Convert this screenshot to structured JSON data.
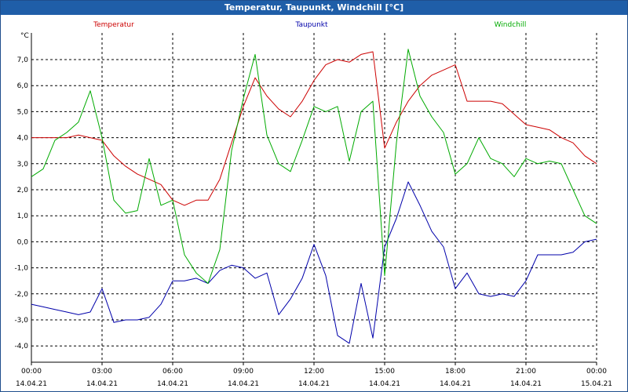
{
  "window": {
    "title": "Temperatur, Taupunkt, Windchill [°C]"
  },
  "colors": {
    "temperatur": "#cc0000",
    "taupunkt": "#0000aa",
    "windchill": "#00aa00",
    "grid": "#000000",
    "titlebar": "#1f5ea8"
  },
  "chart_data": {
    "type": "line",
    "title": "Temperatur, Taupunkt, Windchill [°C]",
    "ylabel": "°C",
    "ylim": [
      -4.5,
      8.0
    ],
    "xlim": [
      0,
      24
    ],
    "y_ticks": [
      "7,0",
      "6,0",
      "5,0",
      "4,0",
      "3,0",
      "2,0",
      "1,0",
      "0,0",
      "-1,0",
      "-2,0",
      "-3,0",
      "-4,0"
    ],
    "y_tick_values": [
      7,
      6,
      5,
      4,
      3,
      2,
      1,
      0,
      -1,
      -2,
      -3,
      -4
    ],
    "x_ticks": [
      {
        "time": "00:00",
        "date": "14.04.21",
        "hour": 0
      },
      {
        "time": "03:00",
        "date": "14.04.21",
        "hour": 3
      },
      {
        "time": "06:00",
        "date": "14.04.21",
        "hour": 6
      },
      {
        "time": "09:00",
        "date": "14.04.21",
        "hour": 9
      },
      {
        "time": "12:00",
        "date": "14.04.21",
        "hour": 12
      },
      {
        "time": "15:00",
        "date": "14.04.21",
        "hour": 15
      },
      {
        "time": "18:00",
        "date": "14.04.21",
        "hour": 18
      },
      {
        "time": "21:00",
        "date": "14.04.21",
        "hour": 21
      },
      {
        "time": "00:00",
        "date": "15.04.21",
        "hour": 24
      }
    ],
    "legend": [
      "Temperatur",
      "Taupunkt",
      "Windchill"
    ],
    "series": [
      {
        "name": "Temperatur",
        "color": "#cc0000",
        "x": [
          0,
          0.5,
          1,
          1.5,
          2,
          2.5,
          3,
          3.5,
          4,
          4.5,
          5,
          5.5,
          6,
          6.5,
          7,
          7.5,
          8,
          8.5,
          9,
          9.5,
          10,
          10.5,
          11,
          11.5,
          12,
          12.5,
          13,
          13.5,
          14,
          14.5,
          15,
          15.5,
          16,
          16.5,
          17,
          17.5,
          18,
          18.5,
          19,
          19.5,
          20,
          20.5,
          21,
          21.5,
          22,
          22.5,
          23,
          23.5,
          24
        ],
        "y": [
          4.0,
          4.0,
          4.0,
          4.0,
          4.1,
          4.0,
          3.9,
          3.3,
          2.9,
          2.6,
          2.4,
          2.2,
          1.6,
          1.4,
          1.6,
          1.6,
          2.4,
          3.8,
          5.2,
          6.3,
          5.6,
          5.1,
          4.8,
          5.4,
          6.2,
          6.8,
          7.0,
          6.9,
          7.2,
          7.3,
          3.6,
          4.6,
          5.4,
          6.0,
          6.4,
          6.6,
          6.8,
          5.4,
          5.4,
          5.4,
          5.3,
          4.9,
          4.5,
          4.4,
          4.3,
          4.0,
          3.8,
          3.3,
          3.0
        ]
      },
      {
        "name": "Taupunkt",
        "color": "#0000aa",
        "x": [
          0,
          0.5,
          1,
          1.5,
          2,
          2.5,
          3,
          3.5,
          4,
          4.5,
          5,
          5.5,
          6,
          6.5,
          7,
          7.5,
          8,
          8.5,
          9,
          9.5,
          10,
          10.5,
          11,
          11.5,
          12,
          12.5,
          13,
          13.5,
          14,
          14.5,
          15,
          15.5,
          16,
          16.5,
          17,
          17.5,
          18,
          18.5,
          19,
          19.5,
          20,
          20.5,
          21,
          21.5,
          22,
          22.5,
          23,
          23.5,
          24
        ],
        "y": [
          -2.4,
          -2.5,
          -2.6,
          -2.7,
          -2.8,
          -2.7,
          -1.8,
          -3.1,
          -3.0,
          -3.0,
          -2.9,
          -2.4,
          -1.5,
          -1.5,
          -1.4,
          -1.6,
          -1.1,
          -0.9,
          -1.0,
          -1.4,
          -1.2,
          -2.8,
          -2.2,
          -1.4,
          -0.1,
          -1.3,
          -3.6,
          -3.9,
          -1.6,
          -3.7,
          -0.2,
          0.9,
          2.3,
          1.4,
          0.4,
          -0.2,
          -1.8,
          -1.2,
          -2.0,
          -2.1,
          -2.0,
          -2.1,
          -1.5,
          -0.5,
          -0.5,
          -0.5,
          -0.4,
          0.0,
          0.1
        ]
      },
      {
        "name": "Windchill",
        "color": "#00aa00",
        "x": [
          0,
          0.5,
          1,
          1.5,
          2,
          2.5,
          3,
          3.5,
          4,
          4.5,
          5,
          5.5,
          6,
          6.5,
          7,
          7.5,
          8,
          8.5,
          9,
          9.5,
          10,
          10.5,
          11,
          11.5,
          12,
          12.5,
          13,
          13.5,
          14,
          14.5,
          15,
          15.5,
          16,
          16.5,
          17,
          17.5,
          18,
          18.5,
          19,
          19.5,
          20,
          20.5,
          21,
          21.5,
          22,
          22.5,
          23,
          23.5,
          24
        ],
        "y": [
          2.5,
          2.8,
          3.9,
          4.2,
          4.6,
          5.8,
          4.0,
          1.6,
          1.1,
          1.2,
          3.2,
          1.4,
          1.6,
          -0.5,
          -1.2,
          -1.6,
          -0.3,
          3.5,
          5.5,
          7.2,
          4.1,
          3.0,
          2.7,
          3.9,
          5.2,
          5.0,
          5.2,
          3.1,
          5.0,
          5.4,
          -1.3,
          3.8,
          7.4,
          5.6,
          4.8,
          4.2,
          2.6,
          3.0,
          4.0,
          3.2,
          3.0,
          2.5,
          3.2,
          3.0,
          3.1,
          3.0,
          2.0,
          1.0,
          0.7
        ]
      }
    ]
  }
}
